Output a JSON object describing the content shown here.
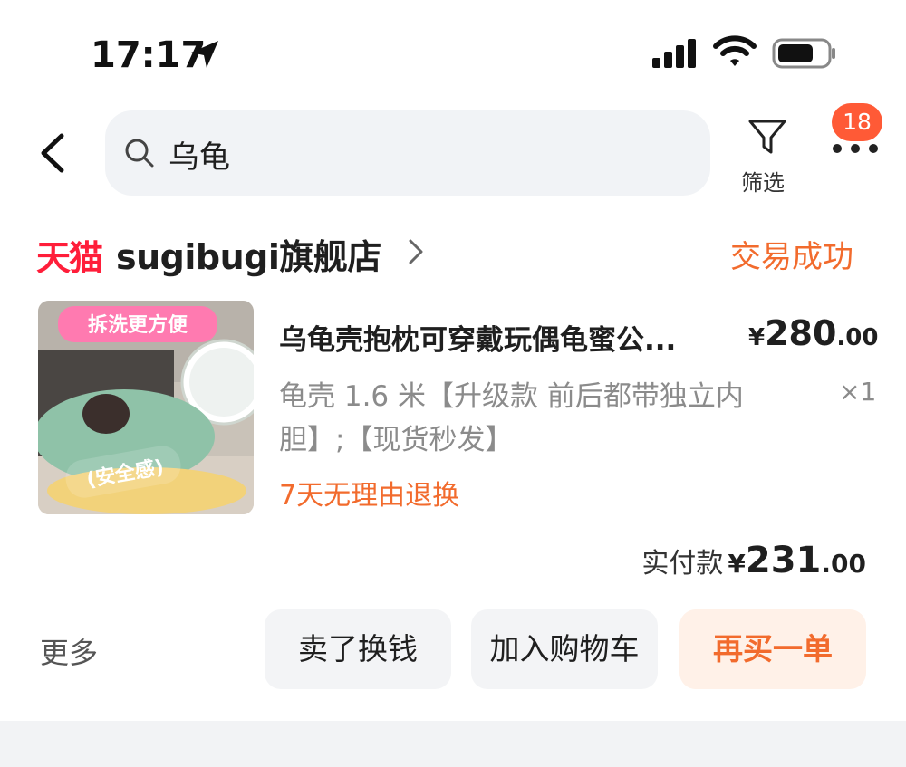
{
  "status_bar": {
    "time": "17:17",
    "icons": [
      "location-arrow-icon",
      "signal-icon",
      "wifi-icon",
      "battery-icon"
    ]
  },
  "header": {
    "back_icon": "chevron-left-icon",
    "search_query": "乌龟",
    "filter_label": "筛选",
    "more_icon": "ellipsis-icon",
    "notification_count": "18"
  },
  "store": {
    "platform_logo": "天猫",
    "name": "sugibugi旗舰店",
    "order_status": "交易成功"
  },
  "product": {
    "thumbnail_overlay_text": [
      "拆洗更方便",
      "(安全感)"
    ],
    "title": "乌龟壳抱枕可穿戴玩偶龟蜜公...",
    "unit_price_currency": "¥",
    "unit_price_int": "280",
    "unit_price_dec": ".00",
    "sku": "龟壳 1.6 米【升级款 前后都带独立内胆】;【现货秒发】",
    "quantity": "×1",
    "return_policy": "7天无理由退换"
  },
  "payment": {
    "label": "实付款",
    "currency": "¥",
    "amount_int": "231",
    "amount_dec": ".00"
  },
  "actions": {
    "more": "更多",
    "sell": "卖了换钱",
    "add_to_cart": "加入购物车",
    "rebuy": "再买一单"
  },
  "colors": {
    "accent_orange": "#f26b2d",
    "tmall_red": "#ff1e3a",
    "badge_red": "#ff5a36",
    "search_bg": "#f1f3f6"
  }
}
